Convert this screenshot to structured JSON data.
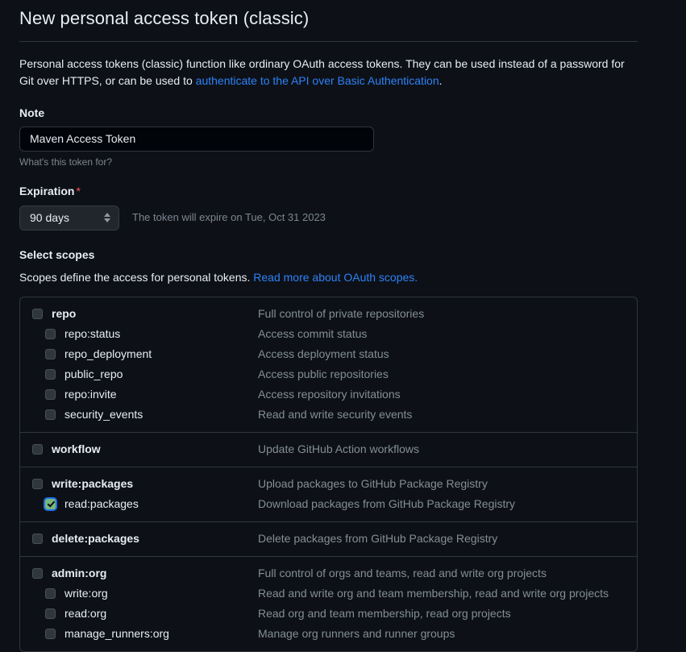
{
  "header": {
    "title": "New personal access token (classic)"
  },
  "intro": {
    "text_before": "Personal access tokens (classic) function like ordinary OAuth access tokens. They can be used instead of a password for Git over HTTPS, or can be used to ",
    "link_text": "authenticate to the API over Basic Authentication",
    "text_after": "."
  },
  "note": {
    "label": "Note",
    "value": "Maven Access Token",
    "placeholder": "What's this token for?",
    "hint": "What's this token for?"
  },
  "expiration": {
    "label": "Expiration",
    "required_marker": "*",
    "selected": "90 days",
    "note": "The token will expire on Tue, Oct 31 2023"
  },
  "scopes": {
    "heading": "Select scopes",
    "description_before": "Scopes define the access for personal tokens. ",
    "description_link": "Read more about OAuth scopes.",
    "colors": {
      "link": "#2f81f7",
      "required": "#f85149",
      "checkbox_checked": "#7ab87a",
      "focus_ring": "#1f6feb",
      "border": "#30363d",
      "background": "#0d1117",
      "description_text": "#848d97"
    },
    "groups": [
      {
        "items": [
          {
            "name": "repo",
            "description": "Full control of private repositories",
            "checked": false,
            "child": false
          },
          {
            "name": "repo:status",
            "description": "Access commit status",
            "checked": false,
            "child": true
          },
          {
            "name": "repo_deployment",
            "description": "Access deployment status",
            "checked": false,
            "child": true
          },
          {
            "name": "public_repo",
            "description": "Access public repositories",
            "checked": false,
            "child": true
          },
          {
            "name": "repo:invite",
            "description": "Access repository invitations",
            "checked": false,
            "child": true
          },
          {
            "name": "security_events",
            "description": "Read and write security events",
            "checked": false,
            "child": true
          }
        ]
      },
      {
        "items": [
          {
            "name": "workflow",
            "description": "Update GitHub Action workflows",
            "checked": false,
            "child": false
          }
        ]
      },
      {
        "items": [
          {
            "name": "write:packages",
            "description": "Upload packages to GitHub Package Registry",
            "checked": false,
            "child": false
          },
          {
            "name": "read:packages",
            "description": "Download packages from GitHub Package Registry",
            "checked": true,
            "child": true
          }
        ]
      },
      {
        "items": [
          {
            "name": "delete:packages",
            "description": "Delete packages from GitHub Package Registry",
            "checked": false,
            "child": false
          }
        ]
      },
      {
        "items": [
          {
            "name": "admin:org",
            "description": "Full control of orgs and teams, read and write org projects",
            "checked": false,
            "child": false
          },
          {
            "name": "write:org",
            "description": "Read and write org and team membership, read and write org projects",
            "checked": false,
            "child": true
          },
          {
            "name": "read:org",
            "description": "Read org and team membership, read org projects",
            "checked": false,
            "child": true
          },
          {
            "name": "manage_runners:org",
            "description": "Manage org runners and runner groups",
            "checked": false,
            "child": true
          }
        ]
      }
    ]
  }
}
